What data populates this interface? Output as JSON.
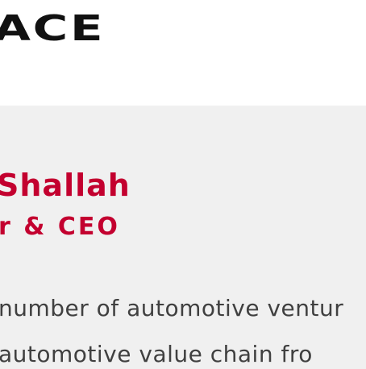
{
  "header": {
    "logo_text": "ACE"
  },
  "profile": {
    "name": "Shallah",
    "role": "r & CEO",
    "bio_lines": [
      "number of automotive ventur",
      " automotive value chain fro"
    ]
  },
  "colors": {
    "accent": "#c3002f",
    "header_bg": "#ffffff",
    "content_bg": "#f0f0f0",
    "logo": "#111111",
    "body_text": "#404040"
  }
}
